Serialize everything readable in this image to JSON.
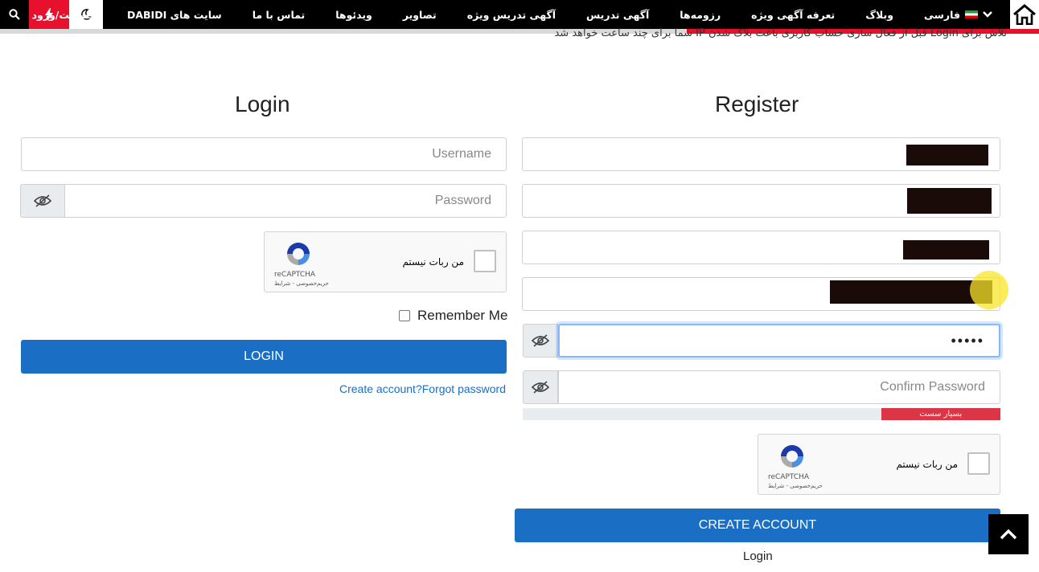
{
  "nav": {
    "items": [
      "فارسی",
      "وبلاگ",
      "تعرفه آگهی ویژه",
      "رزومه‌ها",
      "آگهی تدریس",
      "آگهی تدریس ویژه",
      "تصاویر",
      "ویدئوها",
      "تماس با ما",
      "سایت های DABIDI",
      "عضویت/ورود"
    ],
    "icons": {
      "home": "home-icon",
      "search": "search-icon",
      "flash": "flash-icon",
      "dark": "moon-icon"
    }
  },
  "notice": "تلاش برای Login قبل از فعال سازی حساب کاربری باعث بلاک شدن IP شما برای چند ساعت خواهد شد",
  "login": {
    "title": "Login",
    "username_placeholder": "Username",
    "password_placeholder": "Password",
    "remember_label": "Remember Me",
    "button_label": "LOGIN",
    "create_account_link": "Create account?",
    "forgot_link": "Forgot password"
  },
  "captcha": {
    "label": "من ربات نیستم",
    "brand": "reCAPTCHA",
    "terms": "حریم‌خصوصی - شرایط"
  },
  "register": {
    "title": "Register",
    "password_value": "•••••",
    "confirm_placeholder": "Confirm Password",
    "strength_label": "بسیار سست",
    "strength_fraction": 0.25,
    "button_label": "CREATE ACCOUNT",
    "login_link": "Login"
  },
  "colors": {
    "accent": "#1a6fc4",
    "brand_red": "#e8112d",
    "danger": "#dc3545"
  }
}
